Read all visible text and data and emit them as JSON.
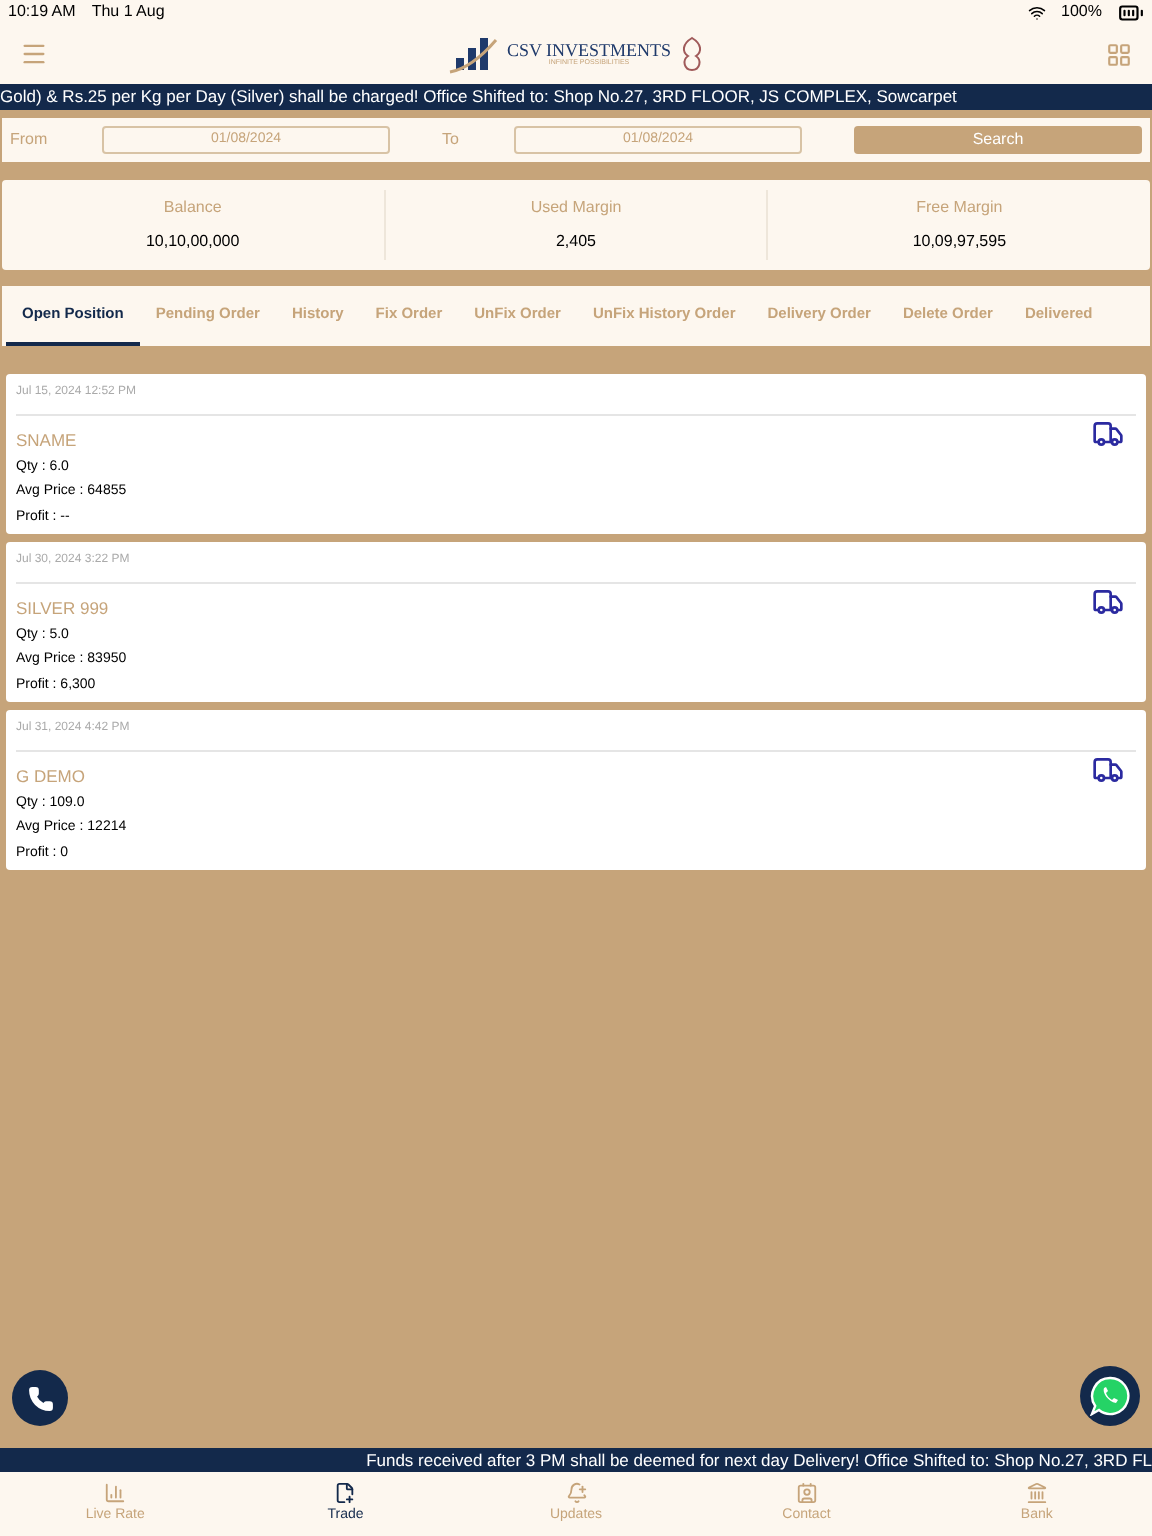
{
  "status_bar": {
    "time": "10:19 AM",
    "date": "Thu 1 Aug",
    "battery": "100%"
  },
  "header": {
    "brand": "CSV INVESTMENTS",
    "tagline": "INFINITE POSSIBILITIES"
  },
  "top_ticker": "Gold) & Rs.25 per Kg per Day (Silver) shall be charged! Office Shifted to: Shop No.27, 3RD FLOOR, JS COMPLEX, Sowcarpet",
  "filter": {
    "from_label": "From",
    "from_value": "01/08/2024",
    "to_label": "To",
    "to_value": "01/08/2024",
    "search_button": "Search"
  },
  "summary": [
    {
      "label": "Balance",
      "value": "10,10,00,000"
    },
    {
      "label": "Used Margin",
      "value": "2,405"
    },
    {
      "label": "Free Margin",
      "value": "10,09,97,595"
    }
  ],
  "tabs": [
    {
      "label": "Open Position",
      "selected": true
    },
    {
      "label": "Pending Order",
      "selected": false
    },
    {
      "label": "History",
      "selected": false
    },
    {
      "label": "Fix Order",
      "selected": false
    },
    {
      "label": "UnFix Order",
      "selected": false
    },
    {
      "label": "UnFix History Order",
      "selected": false
    },
    {
      "label": "Delivery Order",
      "selected": false
    },
    {
      "label": "Delete Order",
      "selected": false
    },
    {
      "label": "Delivered",
      "selected": false
    }
  ],
  "positions": [
    {
      "time": "Jul 15, 2024 12:52 PM",
      "name": "SNAME",
      "qty": "Qty : 6.0",
      "avg_price": "Avg Price : 64855",
      "profit": "Profit : --"
    },
    {
      "time": "Jul 30, 2024 3:22 PM",
      "name": "SILVER 999",
      "qty": "Qty : 5.0",
      "avg_price": "Avg Price : 83950",
      "profit": "Profit : 6,300"
    },
    {
      "time": "Jul 31, 2024 4:42 PM",
      "name": "G DEMO",
      "qty": "Qty : 109.0",
      "avg_price": "Avg Price : 12214",
      "profit": "Profit : 0"
    }
  ],
  "bottom_ticker": "Funds received after 3 PM shall be deemed for next day Delivery! Office Shifted to: Shop No.27, 3RD FL",
  "nav": [
    {
      "label": "Live Rate",
      "kind": "chart",
      "selected": false
    },
    {
      "label": "Trade",
      "kind": "trade",
      "selected": true
    },
    {
      "label": "Updates",
      "kind": "bell",
      "selected": false
    },
    {
      "label": "Contact",
      "kind": "contact",
      "selected": false
    },
    {
      "label": "Bank",
      "kind": "bank",
      "selected": false
    }
  ]
}
